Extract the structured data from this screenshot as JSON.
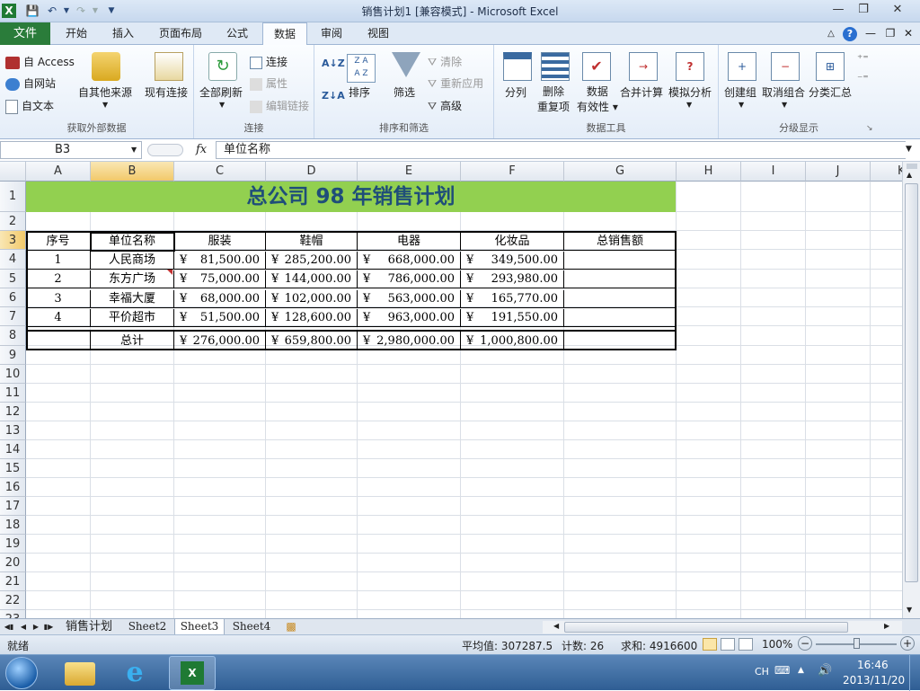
{
  "window": {
    "title": "销售计划1  [兼容模式] - Microsoft Excel"
  },
  "tabs": [
    "开始",
    "插入",
    "页面布局",
    "公式",
    "数据",
    "审阅",
    "视图"
  ],
  "file_tab": "文件",
  "ribbon": {
    "get_external": {
      "access": "自 Access",
      "web": "自网站",
      "text": "自文本",
      "other": "自其他来源",
      "existing": "现有连接",
      "label": "获取外部数据"
    },
    "connections": {
      "refresh_all": "全部刷新",
      "connections": "连接",
      "properties": "属性",
      "edit_links": "编辑链接",
      "label": "连接"
    },
    "sort_filter": {
      "sort": "排序",
      "filter": "筛选",
      "clear": "清除",
      "reapply": "重新应用",
      "advanced": "高级",
      "label": "排序和筛选"
    },
    "data_tools": {
      "split": "分列",
      "remove_dup_1": "删除",
      "remove_dup_2": "重复项",
      "validation_1": "数据",
      "validation_2": "有效性",
      "consolidate": "合并计算",
      "whatif": "模拟分析",
      "label": "数据工具"
    },
    "outline": {
      "group": "创建组",
      "ungroup": "取消组合",
      "subtotal": "分类汇总",
      "label": "分级显示"
    }
  },
  "formula_bar": {
    "name_box": "B3",
    "fx": "fx",
    "formula": "单位名称"
  },
  "columns": [
    "A",
    "B",
    "C",
    "D",
    "E",
    "F",
    "G",
    "H",
    "I",
    "J",
    "K"
  ],
  "rows": [
    "1",
    "2",
    "3",
    "4",
    "5",
    "6",
    "7",
    "8",
    "9",
    "10",
    "11",
    "12",
    "13",
    "14",
    "15",
    "16",
    "17",
    "18",
    "19",
    "20",
    "21",
    "22",
    "23"
  ],
  "sheet": {
    "title": "总公司  98  年销售计划",
    "headers": [
      "序号",
      "单位名称",
      "服装",
      "鞋帽",
      "电器",
      "化妆品",
      "总销售额"
    ],
    "currency": "¥",
    "data": [
      [
        "1",
        "人民商场",
        "81,500.00",
        "285,200.00",
        "668,000.00",
        "349,500.00"
      ],
      [
        "2",
        "东方广场",
        "75,000.00",
        "144,000.00",
        "786,000.00",
        "293,980.00"
      ],
      [
        "3",
        "幸福大厦",
        "68,000.00",
        "102,000.00",
        "563,000.00",
        "165,770.00"
      ],
      [
        "4",
        "平价超市",
        "51,500.00",
        "128,600.00",
        "963,000.00",
        "191,550.00"
      ]
    ],
    "total": [
      "",
      "总计",
      "276,000.00",
      "659,800.00",
      "2,980,000.00",
      "1,000,800.00"
    ]
  },
  "sheet_tabs": [
    "销售计划",
    "Sheet2",
    "Sheet3",
    "Sheet4"
  ],
  "status": {
    "ready": "就绪",
    "average": "平均值: 307287.5",
    "count": "计数: 26",
    "sum": "求和: 4916600",
    "zoom": "100%"
  },
  "taskbar": {
    "lang": "CH",
    "time": "16:46",
    "date": "2013/11/20"
  }
}
